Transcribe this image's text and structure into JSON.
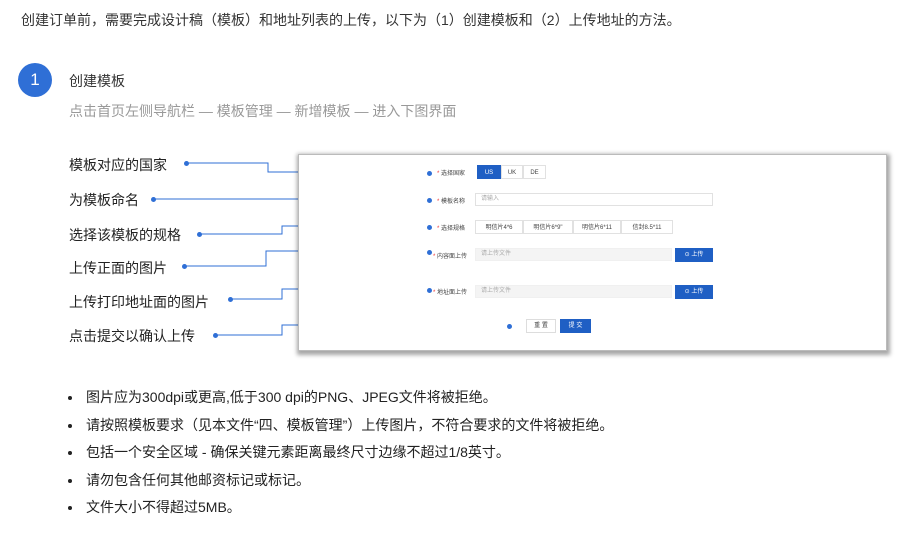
{
  "intro": "创建订单前，需要完成设计稿（模板）和地址列表的上传，以下为（1）创建模板和（2）上传地址的方法。",
  "step": {
    "number": "1",
    "title": "创建模板",
    "path": "点击首页左侧导航栏 — 模板管理 — 新增模板 — 进入下图界面"
  },
  "annotations": [
    "模板对应的国家",
    "为模板命名",
    "选择该模板的规格",
    "上传正面的图片",
    "上传打印地址面的图片",
    "点击提交以确认上传"
  ],
  "form": {
    "country_label": "选择国家",
    "countries": [
      "US",
      "UK",
      "DE"
    ],
    "selected_country": "US",
    "name_label": "模板名称",
    "name_placeholder": "请输入",
    "spec_label": "选择规格",
    "specs": [
      "明信片4*6",
      "明信片6*9\"",
      "明信片6*11",
      "信封8.5*11"
    ],
    "front_label": "内容面上传",
    "front_placeholder": "请上传文件",
    "upload_label": "上传",
    "address_label": "地址面上传",
    "address_placeholder": "请上传文件",
    "reset_label": "重 置",
    "submit_label": "提 交",
    "accent_color": "#1f5fc4",
    "upload_icon": "upload-icon"
  },
  "rules": [
    "图片应为300dpi或更高,低于300 dpi的PNG、JPEG文件将被拒绝。",
    "请按照模板要求（见本文件“四、模板管理”）上传图片，不符合要求的文件将被拒绝。",
    "包括一个安全区域 - 确保关键元素距离最终尺寸边缘不超过1/8英寸。",
    "请勿包含任何其他邮资标记或标记。",
    "文件大小不得超过5MB。"
  ]
}
